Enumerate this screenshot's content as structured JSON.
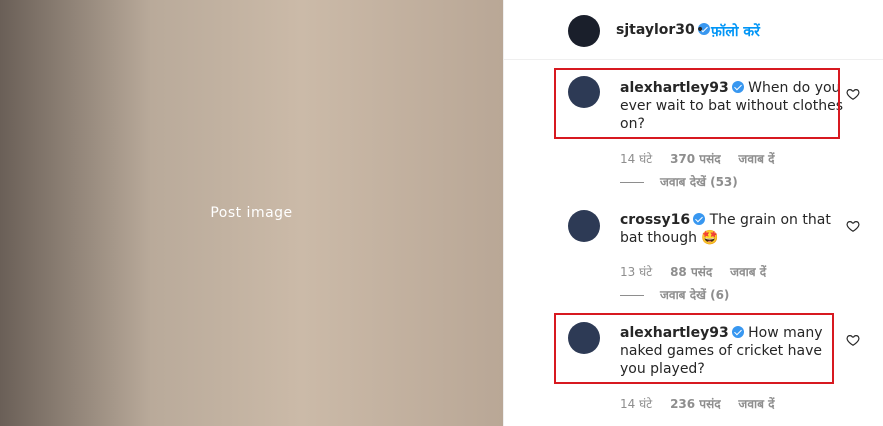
{
  "post": {
    "username": "sjtaylor30",
    "follow_label": "फ़ॉलो करें",
    "separator": "•"
  },
  "photo": {
    "label": "Post image"
  },
  "comments": [
    {
      "username": "alexhartley93",
      "text": "When do you ever wait to bat without clothes on?",
      "time": "14 घंटे",
      "likes": "370 पसंद",
      "reply": "जवाब दें",
      "view_replies": "जवाब देखें (53)",
      "highlighted": true
    },
    {
      "username": "crossy16",
      "text": "The grain on that bat though 🤩",
      "time": "13 घंटे",
      "likes": "88 पसंद",
      "reply": "जवाब दें",
      "view_replies": "जवाब देखें (6)",
      "highlighted": false
    },
    {
      "username": "alexhartley93",
      "text": "How many naked games of cricket have you played?",
      "time": "14 घंटे",
      "likes": "236 पसंद",
      "reply": "जवाब दें",
      "highlighted": true
    }
  ],
  "colors": {
    "highlight_border": "#d71920",
    "link_blue": "#0095f6",
    "muted_text": "#8e8e8e"
  }
}
